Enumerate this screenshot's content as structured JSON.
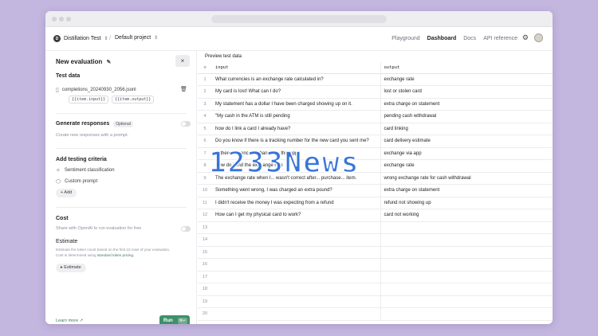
{
  "nav": {
    "org_initial": "D",
    "project": "Distillation Test",
    "separator": "/",
    "sub_project": "Default project",
    "links": [
      "Playground",
      "Dashboard",
      "Docs",
      "API reference"
    ]
  },
  "panel": {
    "title": "New evaluation",
    "close": "×",
    "test_data_heading": "Test data",
    "file_name": "completions_20240930_2056.jsonl",
    "tags": [
      "{{item.input}}",
      "{{item.output}}"
    ],
    "generate_heading": "Generate responses",
    "generate_badge": "Optional",
    "generate_desc": "Create new responses with a prompt.",
    "criteria_heading": "Add testing criteria",
    "criteria": [
      "Sentiment classification",
      "Custom prompt"
    ],
    "add_label": "+ Add",
    "cost_heading": "Cost",
    "cost_share": "Share with OpenAI to run evaluation for free",
    "estimate_heading": "Estimate",
    "estimate_desc_1": "Estimate the token count based on the first 10 rows of your evaluation.",
    "estimate_desc_2": "Cost is determined using",
    "estimate_link": "standard token pricing.",
    "estimate_button": "▸ Estimate",
    "learn_more": "Learn more ↗",
    "run": "Run",
    "run_kbd": "⌘↵"
  },
  "preview": {
    "label": "Preview test data",
    "columns": [
      "input",
      "output"
    ],
    "rows": [
      {
        "n": "1",
        "input": "What currencies is an exchange rate calculated in?",
        "output": "exchange rate"
      },
      {
        "n": "2",
        "input": "My card is lost! What can I do?",
        "output": "lost or stolen card"
      },
      {
        "n": "3",
        "input": "My statement has a dollar I have been charged showing up on it.",
        "output": "extra charge on statement"
      },
      {
        "n": "4",
        "input": "\"My cash in the ATM is still pending",
        "output": "pending cash withdrawal"
      },
      {
        "n": "5",
        "input": "how do I link a card I already have?",
        "output": "card linking"
      },
      {
        "n": "6",
        "input": "Do you know if there is a tracking number for the new card you sent me?",
        "output": "card delivery estimate"
      },
      {
        "n": "7",
        "input": "Is there currency exchange on this app?",
        "output": "exchange via app"
      },
      {
        "n": "8",
        "input": "How do I find the exchange rate",
        "output": "exchange rate"
      },
      {
        "n": "9",
        "input": "The exchange rate when I... wasn't correct after... purchase... item.",
        "output": "wrong exchange rate for cash withdrawal"
      },
      {
        "n": "10",
        "input": "Something went wrong, I was charged an extra pound?",
        "output": "extra charge on statement"
      },
      {
        "n": "11",
        "input": "I didn't receive the money I was expecting from a refund",
        "output": "refund not showing up"
      },
      {
        "n": "12",
        "input": "How can I get my physical card to work?",
        "output": "card not working"
      },
      {
        "n": "13",
        "input": "",
        "output": ""
      },
      {
        "n": "14",
        "input": "",
        "output": ""
      },
      {
        "n": "15",
        "input": "",
        "output": ""
      },
      {
        "n": "16",
        "input": "",
        "output": ""
      },
      {
        "n": "17",
        "input": "",
        "output": ""
      },
      {
        "n": "18",
        "input": "",
        "output": ""
      },
      {
        "n": "19",
        "input": "",
        "output": ""
      },
      {
        "n": "20",
        "input": "",
        "output": ""
      }
    ]
  },
  "watermark": "1233News",
  "colors": {
    "background": "#c3b6df",
    "run_button": "#3f8f68",
    "watermark": "#2f6fd6"
  }
}
